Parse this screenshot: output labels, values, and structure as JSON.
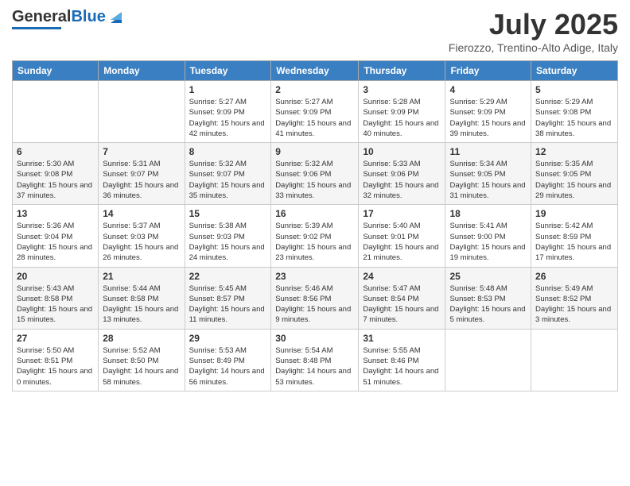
{
  "logo": {
    "general": "General",
    "blue": "Blue"
  },
  "title": "July 2025",
  "subtitle": "Fierozzo, Trentino-Alto Adige, Italy",
  "headers": [
    "Sunday",
    "Monday",
    "Tuesday",
    "Wednesday",
    "Thursday",
    "Friday",
    "Saturday"
  ],
  "weeks": [
    [
      {
        "day": "",
        "info": ""
      },
      {
        "day": "",
        "info": ""
      },
      {
        "day": "1",
        "info": "Sunrise: 5:27 AM\nSunset: 9:09 PM\nDaylight: 15 hours and 42 minutes."
      },
      {
        "day": "2",
        "info": "Sunrise: 5:27 AM\nSunset: 9:09 PM\nDaylight: 15 hours and 41 minutes."
      },
      {
        "day": "3",
        "info": "Sunrise: 5:28 AM\nSunset: 9:09 PM\nDaylight: 15 hours and 40 minutes."
      },
      {
        "day": "4",
        "info": "Sunrise: 5:29 AM\nSunset: 9:09 PM\nDaylight: 15 hours and 39 minutes."
      },
      {
        "day": "5",
        "info": "Sunrise: 5:29 AM\nSunset: 9:08 PM\nDaylight: 15 hours and 38 minutes."
      }
    ],
    [
      {
        "day": "6",
        "info": "Sunrise: 5:30 AM\nSunset: 9:08 PM\nDaylight: 15 hours and 37 minutes."
      },
      {
        "day": "7",
        "info": "Sunrise: 5:31 AM\nSunset: 9:07 PM\nDaylight: 15 hours and 36 minutes."
      },
      {
        "day": "8",
        "info": "Sunrise: 5:32 AM\nSunset: 9:07 PM\nDaylight: 15 hours and 35 minutes."
      },
      {
        "day": "9",
        "info": "Sunrise: 5:32 AM\nSunset: 9:06 PM\nDaylight: 15 hours and 33 minutes."
      },
      {
        "day": "10",
        "info": "Sunrise: 5:33 AM\nSunset: 9:06 PM\nDaylight: 15 hours and 32 minutes."
      },
      {
        "day": "11",
        "info": "Sunrise: 5:34 AM\nSunset: 9:05 PM\nDaylight: 15 hours and 31 minutes."
      },
      {
        "day": "12",
        "info": "Sunrise: 5:35 AM\nSunset: 9:05 PM\nDaylight: 15 hours and 29 minutes."
      }
    ],
    [
      {
        "day": "13",
        "info": "Sunrise: 5:36 AM\nSunset: 9:04 PM\nDaylight: 15 hours and 28 minutes."
      },
      {
        "day": "14",
        "info": "Sunrise: 5:37 AM\nSunset: 9:03 PM\nDaylight: 15 hours and 26 minutes."
      },
      {
        "day": "15",
        "info": "Sunrise: 5:38 AM\nSunset: 9:03 PM\nDaylight: 15 hours and 24 minutes."
      },
      {
        "day": "16",
        "info": "Sunrise: 5:39 AM\nSunset: 9:02 PM\nDaylight: 15 hours and 23 minutes."
      },
      {
        "day": "17",
        "info": "Sunrise: 5:40 AM\nSunset: 9:01 PM\nDaylight: 15 hours and 21 minutes."
      },
      {
        "day": "18",
        "info": "Sunrise: 5:41 AM\nSunset: 9:00 PM\nDaylight: 15 hours and 19 minutes."
      },
      {
        "day": "19",
        "info": "Sunrise: 5:42 AM\nSunset: 8:59 PM\nDaylight: 15 hours and 17 minutes."
      }
    ],
    [
      {
        "day": "20",
        "info": "Sunrise: 5:43 AM\nSunset: 8:58 PM\nDaylight: 15 hours and 15 minutes."
      },
      {
        "day": "21",
        "info": "Sunrise: 5:44 AM\nSunset: 8:58 PM\nDaylight: 15 hours and 13 minutes."
      },
      {
        "day": "22",
        "info": "Sunrise: 5:45 AM\nSunset: 8:57 PM\nDaylight: 15 hours and 11 minutes."
      },
      {
        "day": "23",
        "info": "Sunrise: 5:46 AM\nSunset: 8:56 PM\nDaylight: 15 hours and 9 minutes."
      },
      {
        "day": "24",
        "info": "Sunrise: 5:47 AM\nSunset: 8:54 PM\nDaylight: 15 hours and 7 minutes."
      },
      {
        "day": "25",
        "info": "Sunrise: 5:48 AM\nSunset: 8:53 PM\nDaylight: 15 hours and 5 minutes."
      },
      {
        "day": "26",
        "info": "Sunrise: 5:49 AM\nSunset: 8:52 PM\nDaylight: 15 hours and 3 minutes."
      }
    ],
    [
      {
        "day": "27",
        "info": "Sunrise: 5:50 AM\nSunset: 8:51 PM\nDaylight: 15 hours and 0 minutes."
      },
      {
        "day": "28",
        "info": "Sunrise: 5:52 AM\nSunset: 8:50 PM\nDaylight: 14 hours and 58 minutes."
      },
      {
        "day": "29",
        "info": "Sunrise: 5:53 AM\nSunset: 8:49 PM\nDaylight: 14 hours and 56 minutes."
      },
      {
        "day": "30",
        "info": "Sunrise: 5:54 AM\nSunset: 8:48 PM\nDaylight: 14 hours and 53 minutes."
      },
      {
        "day": "31",
        "info": "Sunrise: 5:55 AM\nSunset: 8:46 PM\nDaylight: 14 hours and 51 minutes."
      },
      {
        "day": "",
        "info": ""
      },
      {
        "day": "",
        "info": ""
      }
    ]
  ]
}
